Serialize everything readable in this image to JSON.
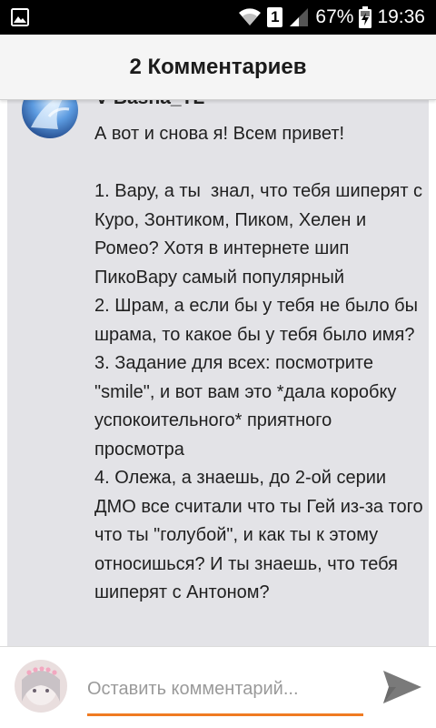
{
  "status_bar": {
    "sim_label": "1",
    "battery_percent": "67%",
    "time": "19:36",
    "icons": [
      "image-notification-icon",
      "wifi-icon",
      "signal-icon",
      "battery-charging-icon"
    ]
  },
  "header": {
    "title": "2 Комментариев"
  },
  "comment": {
    "author": "V-Basha_TL",
    "text": "А вот и снова я! Всем привет!\n\n1. Вару, а ты  знал, что тебя шиперят с Куро, Зонтиком, Пиком, Хелен и Ромео? Хотя в интернете шип ПикоВару самый популярный\n2. Шрам, а если бы у тебя не было бы шрама, то какое бы у тебя было имя?\n3. Задание для всех: посмотрите \"smile\", и вот вам это *дала коробку успокоительного* приятного просмотра\n4. Олежа, а знаешь, до 2-ой серии ДМО все считали что ты Гей из-за того что ты \"голубой\", и как ты к этому относишься? И ты знаешь, что тебя шиперят с Антоном?"
  },
  "footer": {
    "input_placeholder": "Оставить комментарий...",
    "input_value": ""
  },
  "colors": {
    "accent": "#f07b22",
    "card_background": "#e3e3e7",
    "header_background": "#f5f5f5",
    "send_icon": "#7a7a7a"
  }
}
